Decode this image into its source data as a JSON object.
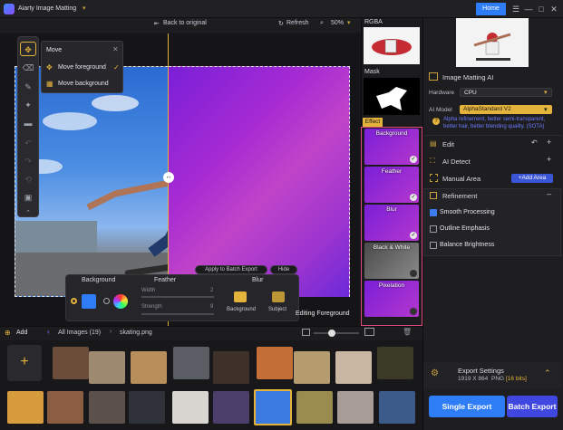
{
  "app": {
    "title": "Aiarty Image Matting",
    "home_label": "Home"
  },
  "window_controls": [
    "☰",
    "—",
    "□",
    "✕"
  ],
  "toolbar": {
    "back_label": "Back to original",
    "refresh_label": "Refresh",
    "zoom": "50%"
  },
  "move_popup": {
    "title": "Move",
    "items": [
      "Move foreground",
      "Move background"
    ]
  },
  "canvas": {
    "batch_apply_label": "Apply to Batch Export",
    "hide_label": "Hide",
    "editing_label": "Editing Foreground"
  },
  "bottom_tools": {
    "background_label": "Background",
    "feather_label": "Feather",
    "blur_label": "Blur",
    "width_label": "Width",
    "width_value": "2",
    "strength_label": "Strength",
    "strength_value": "9",
    "blur_bg_label": "Background",
    "blur_subject_label": "Subject"
  },
  "preview": {
    "rgba_label": "RGBA",
    "mask_label": "Mask",
    "effect_label": "Effect",
    "effects": [
      {
        "label": "Background",
        "checked": true
      },
      {
        "label": "Feather",
        "checked": true
      },
      {
        "label": "Blur",
        "checked": true
      },
      {
        "label": "Black & White",
        "checked": false
      },
      {
        "label": "Pixelation",
        "checked": false
      }
    ]
  },
  "right_panel": {
    "image_matting_label": "Image Matting AI",
    "hardware_label": "Hardware",
    "hardware_value": "CPU",
    "ai_model_label": "AI Model",
    "ai_model_value": "AlphaStandard  V2",
    "ai_model_desc": "Alpha refinement, better semi-transparent, better hair, better blending quality. (SOTA)",
    "edit_label": "Edit",
    "ai_detect_label": "AI Detect",
    "manual_area_label": "Manual Area",
    "add_area_label": "+Add Area",
    "refinement_label": "Refinement",
    "refinement_items": [
      {
        "label": "Smooth Processing",
        "checked": true
      },
      {
        "label": "Outline Emphasis",
        "checked": false
      },
      {
        "label": "Balance Brightness",
        "checked": false
      }
    ],
    "export_settings_label": "Export Settings",
    "export_info": "1919 X 864",
    "export_format": "PNG",
    "export_bits": "[16 bits]",
    "single_export_label": "Single Export",
    "batch_export_label": "Batch Export"
  },
  "gallery": {
    "add_label": "Add",
    "all_images_label": "All Images (19)",
    "current_file": "skating.png",
    "colors": {
      "accent": "#e4b33c",
      "primary": "#2e7cf6",
      "effect_border": "#e3497a"
    }
  }
}
